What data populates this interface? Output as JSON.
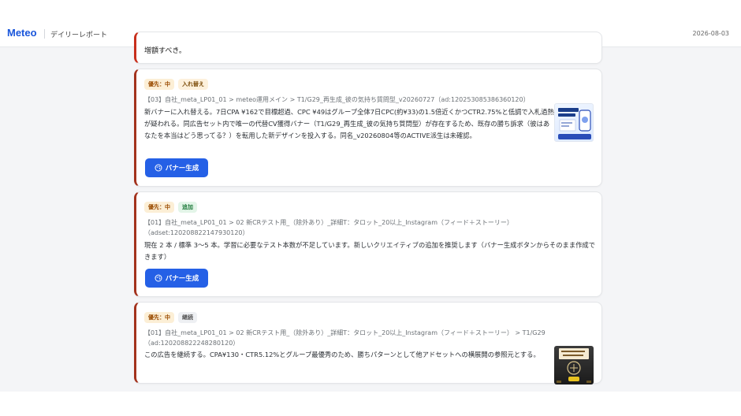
{
  "header": {
    "brand": "Meteo",
    "subtitle": "デイリーレポート",
    "date": "2026-08-03"
  },
  "prev_card": {
    "text": "増額すべき。"
  },
  "cards": [
    {
      "priority": "優先：中",
      "tag": "入れ替え",
      "path": "【03】自社_meta_LP01_01 > meteo運用メイン > T1/G29_再生成_彼の気持ち質問型_v20260727（ad:120253085386360120）",
      "body": "新バナーに入れ替える。7日CPA ¥162で目標超過、CPC ¥49はグループ全体7日CPC(約¥33)の1.5倍近くかつCTR2.75%と低調で入札過熱が疑われる。同広告セット内で唯一の代替CV獲得バナー（T1/G29_再生成_彼の気持ち質問型）が存在するため、既存の勝ち訴求（彼はあなたを本当はどう思ってる？）を転用した新デザインを投入する。同名_v20260804等のACTIVE派生は未確認。",
      "button": "バナー生成",
      "thumbnail": "banner-thumbnail"
    },
    {
      "priority": "優先：中",
      "tag": "追加",
      "path": "【01】自社_meta_LP01_01 > 02 新CRテスト用_（除外あり）_詳細T：タロット_20以上_Instagram（フィード＋ストーリー）（adset:120208822147930120）",
      "body": "現在 2 本 / 標準 3〜5 本。学習に必要なテスト本数が不足しています。新しいクリエイティブの追加を推奨します（バナー生成ボタンからそのまま作成できます）",
      "button": "バナー生成"
    },
    {
      "priority": "優先：中",
      "tag": "継続",
      "path": "【01】自社_meta_LP01_01 > 02 新CRテスト用_（除外あり）_詳細T：タロット_20以上_Instagram（フィード＋ストーリー） > T1/G29（ad:120208822248280120）",
      "body": "この広告を継続する。CPA¥130・CTR5.12%とグループ最優秀のため、勝ちパターンとして他アドセットへの横展開の参照元とする。",
      "thumbnail": "banner-thumbnail"
    }
  ],
  "colors": {
    "brand": "#1a56db",
    "button": "#2560e6",
    "card_accent": "#a3321d",
    "prev_card_accent": "#c82f1c"
  }
}
